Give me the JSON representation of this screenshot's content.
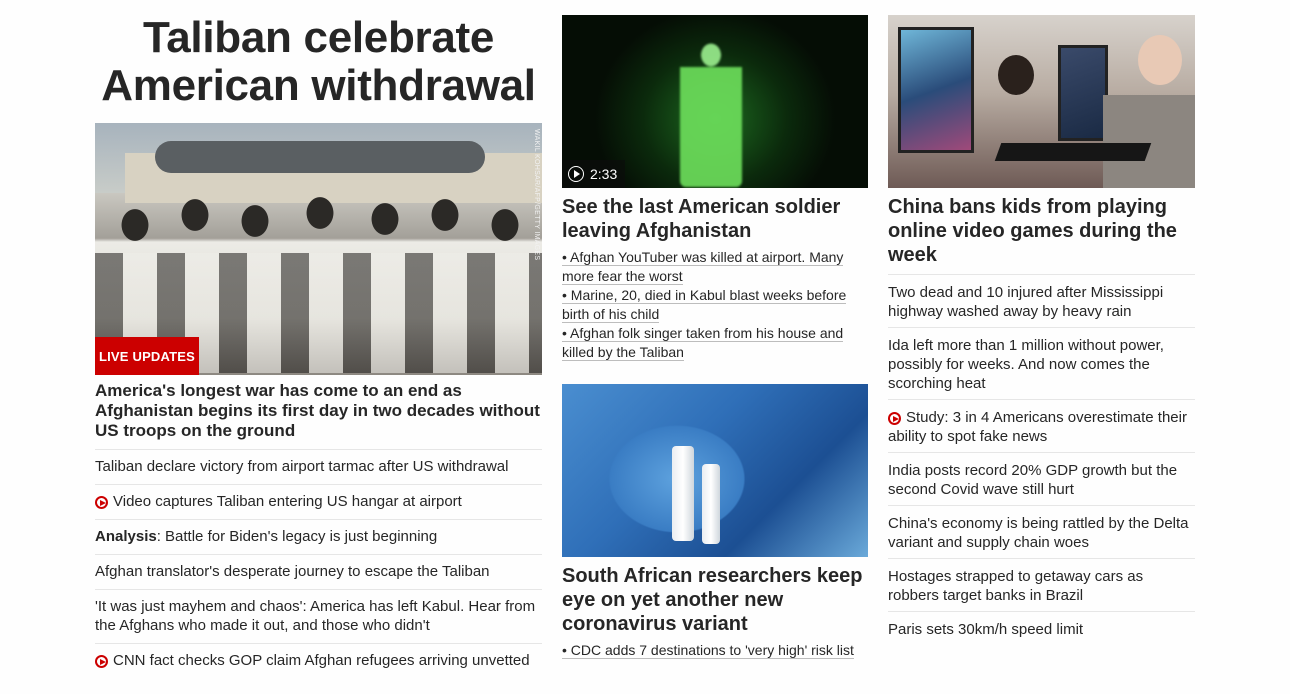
{
  "banner": {
    "headline": "Taliban celebrate American withdrawal"
  },
  "hero": {
    "image_alt": "Taliban members on airport tarmac",
    "photo_credit": "WAKIL KOHSAR/AFP/GETTY IMAGES",
    "badge": "LIVE UPDATES",
    "caption": "America's longest war has come to an end as Afghanistan begins its first day in two decades without US troops on the ground"
  },
  "related": [
    {
      "text": "Taliban declare victory from airport tarmac after US withdrawal"
    },
    {
      "text": "Video captures Taliban entering US hangar at airport",
      "video": true
    },
    {
      "prefix": "Analysis",
      "text": ": Battle for Biden's legacy is just beginning"
    },
    {
      "text": "Afghan translator's desperate journey to escape the Taliban"
    },
    {
      "text": "'It was just mayhem and chaos': America has left Kabul. Hear from the Afghans who made it out, and those who didn't"
    },
    {
      "text": "CNN fact checks GOP claim Afghan refugees arriving unvetted",
      "video": true
    }
  ],
  "soldier_story": {
    "duration": "2:33",
    "headline": "See the last American soldier leaving Afghanistan",
    "subs": [
      "• Afghan YouTuber was killed at airport. Many more fear the worst",
      "• Marine, 20, died in Kabul blast weeks before birth of his child",
      "• Afghan folk singer taken from his house and killed by the Taliban"
    ]
  },
  "variant_story": {
    "headline": "South African researchers keep eye on yet another new coronavirus variant",
    "subs": [
      "• CDC adds 7 destinations to 'very high' risk list"
    ]
  },
  "china_story": {
    "headline": "China bans kids from playing online video games during the week"
  },
  "stories": [
    {
      "text": "Two dead and 10 injured after Mississippi highway washed away by heavy rain"
    },
    {
      "text": "Ida left more than 1 million without power, possibly for weeks. And now comes the scorching heat"
    },
    {
      "text": "Study: 3 in 4 Americans overestimate their ability to spot fake news",
      "video": true
    },
    {
      "text": "India posts record 20% GDP growth but the second Covid wave still hurt"
    },
    {
      "text": "China's economy is being rattled by the Delta variant and supply chain woes"
    },
    {
      "text": "Hostages strapped to getaway cars as robbers target banks in Brazil"
    },
    {
      "text": "Paris sets 30km/h speed limit"
    }
  ],
  "colors": {
    "accent": "#cc0000",
    "text": "#262626",
    "divider": "#e6e6e6"
  }
}
